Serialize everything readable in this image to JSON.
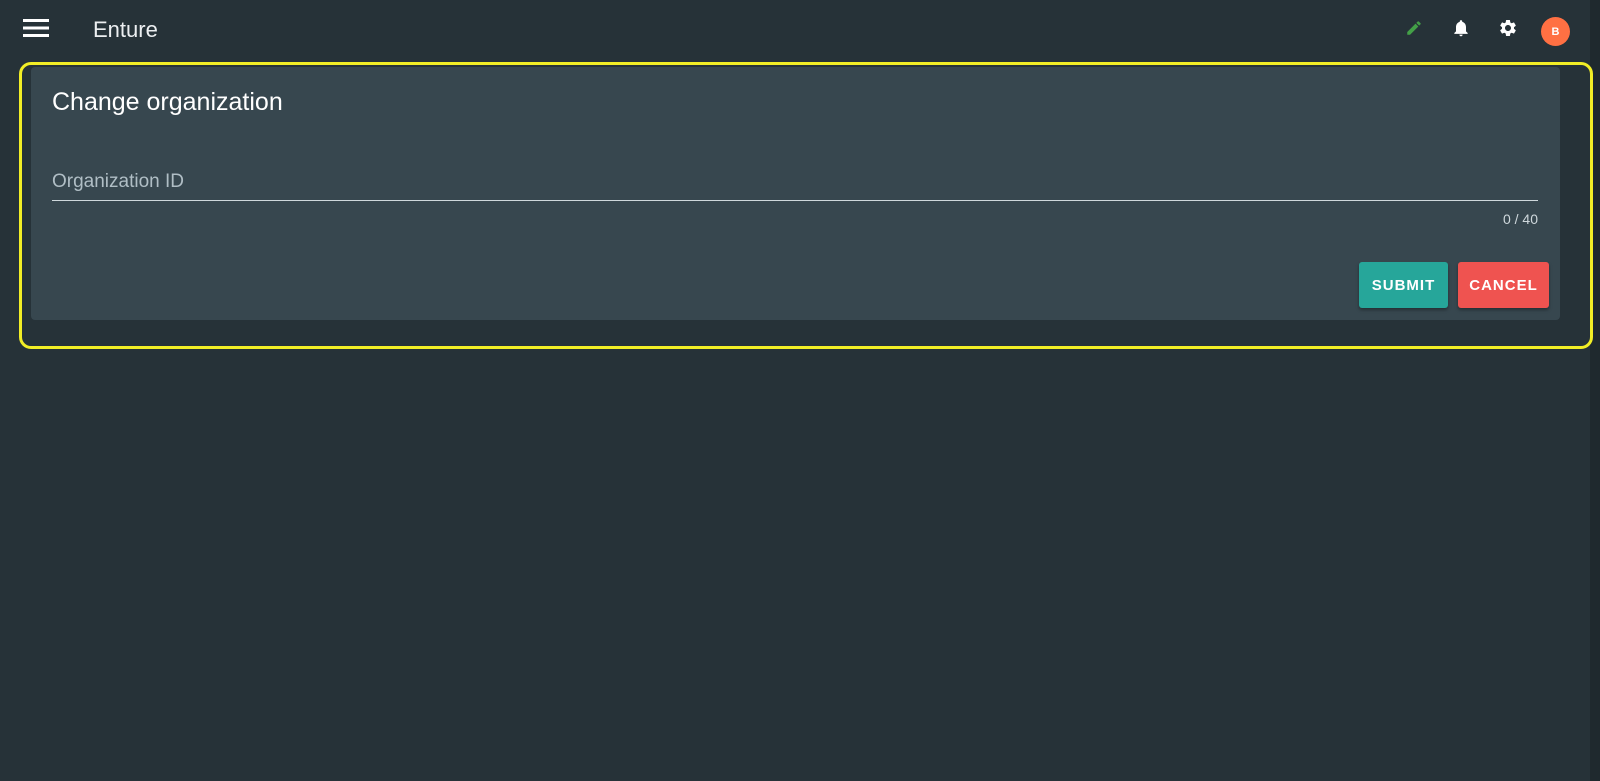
{
  "colors": {
    "background": "#263238",
    "card": "#37474f",
    "submit": "#26a69a",
    "cancel": "#ef5350",
    "avatar": "#ff7043",
    "edit_icon": "#43a047",
    "highlight": "#f2ee26"
  },
  "header": {
    "title": "Enture",
    "icons": [
      "menu-icon",
      "pencil-icon",
      "bell-icon",
      "gear-icon"
    ],
    "avatar_initial": "B"
  },
  "card": {
    "title": "Change organization",
    "field": {
      "placeholder": "Organization ID",
      "value": "",
      "counter": "0 / 40"
    },
    "submit_label": "SUBMIT",
    "cancel_label": "CANCEL"
  }
}
